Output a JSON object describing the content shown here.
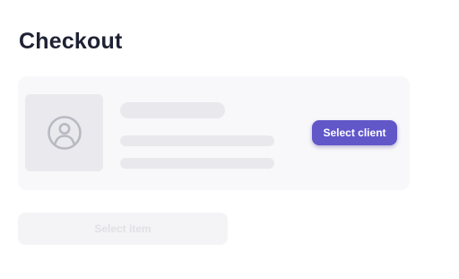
{
  "page": {
    "title": "Checkout"
  },
  "client_card": {
    "avatar_icon": "user-avatar-icon",
    "select_client_label": "Select client"
  },
  "item": {
    "select_item_label": "Select item",
    "disabled": true
  },
  "colors": {
    "accent": "#6157c9",
    "title_text": "#1f2233",
    "card_background": "#f8f8fa",
    "skeleton": "#e8e8ed"
  }
}
